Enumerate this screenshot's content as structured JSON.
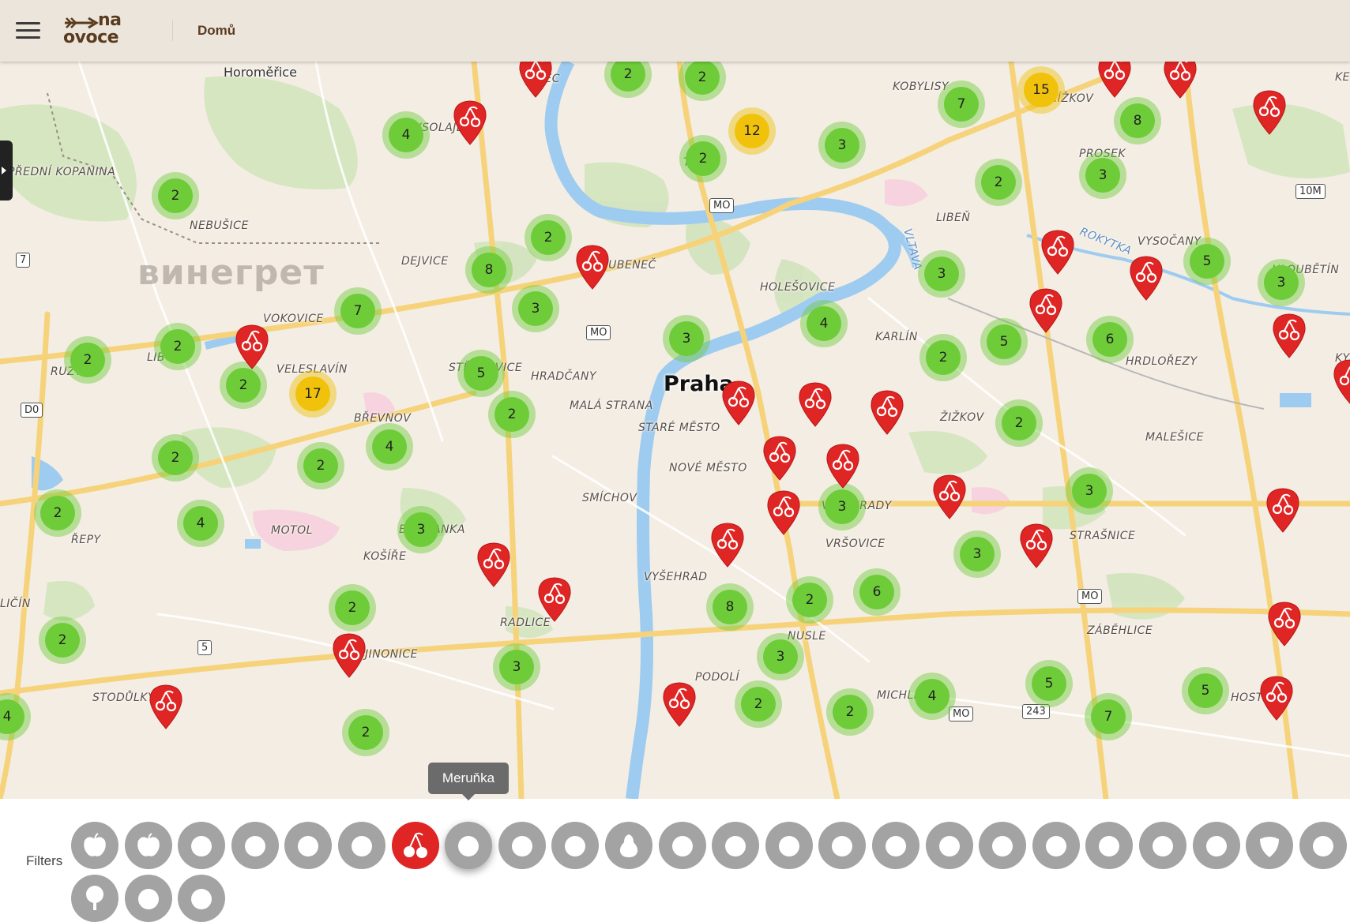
{
  "header": {
    "logo_line1": "na",
    "logo_line2": "ovoce",
    "nav_home": "Domů"
  },
  "map": {
    "brand_watermark": "винегрет",
    "city_label": "Praha",
    "places": [
      "Horoměřice",
      "LYSOLAJE",
      "PŘEDNÍ KOPANINA",
      "NEBUŠICE",
      "DEJVICE",
      "VOKOVICE",
      "LIBOC",
      "RUZYNĚ",
      "VELESLAVÍN",
      "STŘEŠOVICE",
      "HRADČANY",
      "BŘEVNOV",
      "MALÁ STRANA",
      "STARÉ MĚSTO",
      "NOVÉ MĚSTO",
      "SMÍCHOV",
      "MOTOL",
      "ŘEPY",
      "KOŠÍŘE",
      "BUDŇANKA",
      "JINONICE",
      "RADLICE",
      "VYŠEHRAD",
      "STODŮLKY",
      "LIČÍN",
      "TROJA",
      "BUBENEČ",
      "HOLEŠOVICE",
      "KOBYLISY",
      "STŘÍŽKOV",
      "PROSEK",
      "LIBEŇ",
      "VYSOČANY",
      "HLOUBĚTÍN",
      "KARLÍN",
      "ŽIŽKOV",
      "VINOHRADY",
      "VRŠOVICE",
      "NUSLE",
      "MICHLE",
      "STRAŠNICE",
      "MALEŠICE",
      "HRDLOŘEZY",
      "ZÁBĚHLICE",
      "HOSTIVAŘ",
      "PODOLÍ",
      "Rokytka",
      "Vltava",
      "SEC",
      "KY",
      "KE"
    ],
    "road_labels": [
      "MO",
      "MO",
      "MO",
      "MO",
      "7",
      "D0",
      "5",
      "10M",
      "243"
    ],
    "clusters": [
      {
        "count": 2,
        "level": "small"
      },
      {
        "count": 2,
        "level": "small"
      },
      {
        "count": 4,
        "level": "small"
      },
      {
        "count": 12,
        "level": "medium"
      },
      {
        "count": 2,
        "level": "small"
      },
      {
        "count": 3,
        "level": "small"
      },
      {
        "count": 15,
        "level": "medium"
      },
      {
        "count": 7,
        "level": "small"
      },
      {
        "count": 8,
        "level": "small"
      },
      {
        "count": 3,
        "level": "small"
      },
      {
        "count": 2,
        "level": "small"
      },
      {
        "count": 2,
        "level": "small"
      },
      {
        "count": 2,
        "level": "small"
      },
      {
        "count": 8,
        "level": "small"
      },
      {
        "count": 7,
        "level": "small"
      },
      {
        "count": 3,
        "level": "small"
      },
      {
        "count": 2,
        "level": "small"
      },
      {
        "count": 2,
        "level": "small"
      },
      {
        "count": 2,
        "level": "small"
      },
      {
        "count": 17,
        "level": "medium"
      },
      {
        "count": 5,
        "level": "small"
      },
      {
        "count": 3,
        "level": "small"
      },
      {
        "count": 3,
        "level": "small"
      },
      {
        "count": 4,
        "level": "small"
      },
      {
        "count": 3,
        "level": "small"
      },
      {
        "count": 5,
        "level": "small"
      },
      {
        "count": 5,
        "level": "small"
      },
      {
        "count": 6,
        "level": "small"
      },
      {
        "count": 2,
        "level": "small"
      },
      {
        "count": 2,
        "level": "small"
      },
      {
        "count": 2,
        "level": "small"
      },
      {
        "count": 4,
        "level": "small"
      },
      {
        "count": 2,
        "level": "small"
      },
      {
        "count": 2,
        "level": "small"
      },
      {
        "count": 2,
        "level": "small"
      },
      {
        "count": 4,
        "level": "small"
      },
      {
        "count": 3,
        "level": "small"
      },
      {
        "count": 3,
        "level": "small"
      },
      {
        "count": 3,
        "level": "small"
      },
      {
        "count": 2,
        "level": "small"
      },
      {
        "count": 2,
        "level": "small"
      },
      {
        "count": 3,
        "level": "small"
      },
      {
        "count": 8,
        "level": "small"
      },
      {
        "count": 2,
        "level": "small"
      },
      {
        "count": 6,
        "level": "small"
      },
      {
        "count": 3,
        "level": "small"
      },
      {
        "count": 3,
        "level": "small"
      },
      {
        "count": 2,
        "level": "small"
      },
      {
        "count": 2,
        "level": "small"
      },
      {
        "count": 4,
        "level": "small"
      },
      {
        "count": 5,
        "level": "small"
      },
      {
        "count": 7,
        "level": "small"
      },
      {
        "count": 5,
        "level": "small"
      },
      {
        "count": 4,
        "level": "small"
      },
      {
        "count": 2,
        "level": "small"
      }
    ],
    "pin_icon": "cherry-icon",
    "pin_color": "#e02525",
    "cluster_color": "#6ecc39",
    "cluster_medium_color": "#f0c20c"
  },
  "tooltip": {
    "text": "Meruňka"
  },
  "filters": {
    "label": "Filters",
    "active_color": "#e02525",
    "items": [
      {
        "icon": "apple-icon"
      },
      {
        "icon": "apple-icon"
      },
      {
        "icon": "walnut-icon"
      },
      {
        "icon": "fig-icon"
      },
      {
        "icon": "hazelnut-icon"
      },
      {
        "icon": "chestnut-icon"
      },
      {
        "icon": "cherry-icon",
        "active": true
      },
      {
        "icon": "apricot-icon",
        "hover": true
      },
      {
        "icon": "mulberry-icon"
      },
      {
        "icon": "cornel-icon"
      },
      {
        "icon": "pear-icon"
      },
      {
        "icon": "plum-icon"
      },
      {
        "icon": "raspberry-icon"
      },
      {
        "icon": "rosehip-icon"
      },
      {
        "icon": "peach-icon"
      },
      {
        "icon": "currant-icon"
      },
      {
        "icon": "mirabelle-icon"
      },
      {
        "icon": "quince-icon"
      },
      {
        "icon": "medlar-icon"
      },
      {
        "icon": "grape-icon"
      },
      {
        "icon": "sour-cherry-icon"
      },
      {
        "icon": "elderberry-icon"
      },
      {
        "icon": "strawberry-icon"
      },
      {
        "icon": "pomegranate-icon"
      },
      {
        "icon": "citrus-icon"
      },
      {
        "icon": "tree-icon"
      },
      {
        "icon": "berries-icon"
      },
      {
        "icon": "orange-icon"
      }
    ]
  }
}
